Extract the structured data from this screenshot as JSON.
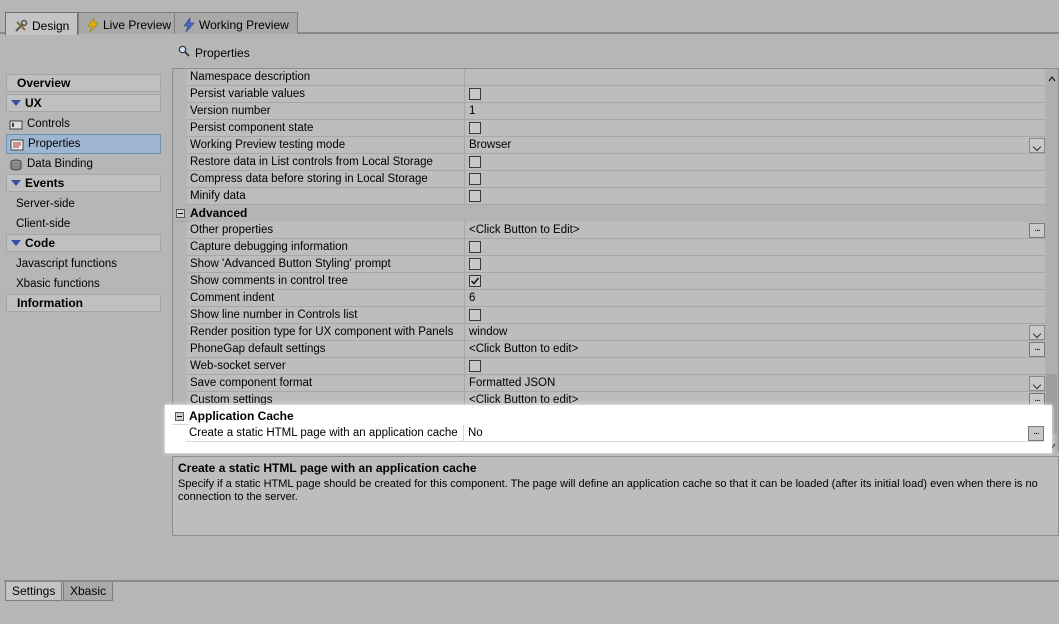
{
  "tabs": [
    {
      "label": "Design",
      "icon": "tools-icon"
    },
    {
      "label": "Live Preview",
      "icon": "lightning-icon"
    },
    {
      "label": "Working Preview",
      "icon": "lightning-blue-icon"
    }
  ],
  "header": {
    "title": "Properties",
    "icon": "search-icon"
  },
  "sidebar": {
    "overview": "Overview",
    "ux": "UX",
    "controls": "Controls",
    "properties": "Properties",
    "data_binding": "Data Binding",
    "events": "Events",
    "server_side": "Server-side",
    "client_side": "Client-side",
    "code": "Code",
    "javascript_functions": "Javascript functions",
    "xbasic_functions": "Xbasic functions",
    "information": "Information"
  },
  "grid": {
    "rows": [
      {
        "label": "Namespace description",
        "value": "",
        "type": "text"
      },
      {
        "label": "Persist variable values",
        "value": "",
        "type": "checkbox",
        "checked": false
      },
      {
        "label": "Version number",
        "value": "1",
        "type": "text"
      },
      {
        "label": "Persist component state",
        "value": "",
        "type": "checkbox",
        "checked": false
      },
      {
        "label": "Working Preview testing mode",
        "value": "Browser",
        "type": "dropdown"
      },
      {
        "label": "Restore data in List controls from Local Storage",
        "value": "",
        "type": "checkbox",
        "checked": false
      },
      {
        "label": "Compress data before storing in Local Storage",
        "value": "",
        "type": "checkbox",
        "checked": false
      },
      {
        "label": "Minify data",
        "value": "",
        "type": "checkbox",
        "checked": false
      }
    ],
    "advanced_title": "Advanced",
    "advanced_rows": [
      {
        "label": "Other properties",
        "value": "<Click Button to Edit>",
        "type": "ellipsis"
      },
      {
        "label": "Capture debugging information",
        "value": "",
        "type": "checkbox",
        "checked": false
      },
      {
        "label": "Show 'Advanced Button Styling' prompt",
        "value": "",
        "type": "checkbox",
        "checked": false
      },
      {
        "label": "Show comments in control tree",
        "value": "",
        "type": "checkbox",
        "checked": true
      },
      {
        "label": "Comment indent",
        "value": "6",
        "type": "text"
      },
      {
        "label": "Show line number in Controls list",
        "value": "",
        "type": "checkbox",
        "checked": false
      },
      {
        "label": "Render position type for UX component with Panels",
        "value": "window",
        "type": "dropdown"
      },
      {
        "label": "PhoneGap default settings",
        "value": "<Click Button to edit>",
        "type": "ellipsis"
      },
      {
        "label": "Web-socket server",
        "value": "",
        "type": "checkbox",
        "checked": false
      },
      {
        "label": "Save component format",
        "value": "Formatted JSON",
        "type": "dropdown"
      },
      {
        "label": "Custom settings",
        "value": "<Click Button to edit>",
        "type": "ellipsis"
      }
    ],
    "appcache_title": "Application Cache",
    "appcache_row": {
      "label": "Create a static HTML page with an application cache",
      "value": "No",
      "type": "ellipsis"
    }
  },
  "description": {
    "title": "Create a static HTML page with an application cache",
    "text": "Specify if a static HTML page should be created for this component. The page will define an application cache so that it can be loaded (after its initial load) even when there is no connection to the server."
  },
  "bottom_tabs": [
    "Settings",
    "Xbasic"
  ]
}
